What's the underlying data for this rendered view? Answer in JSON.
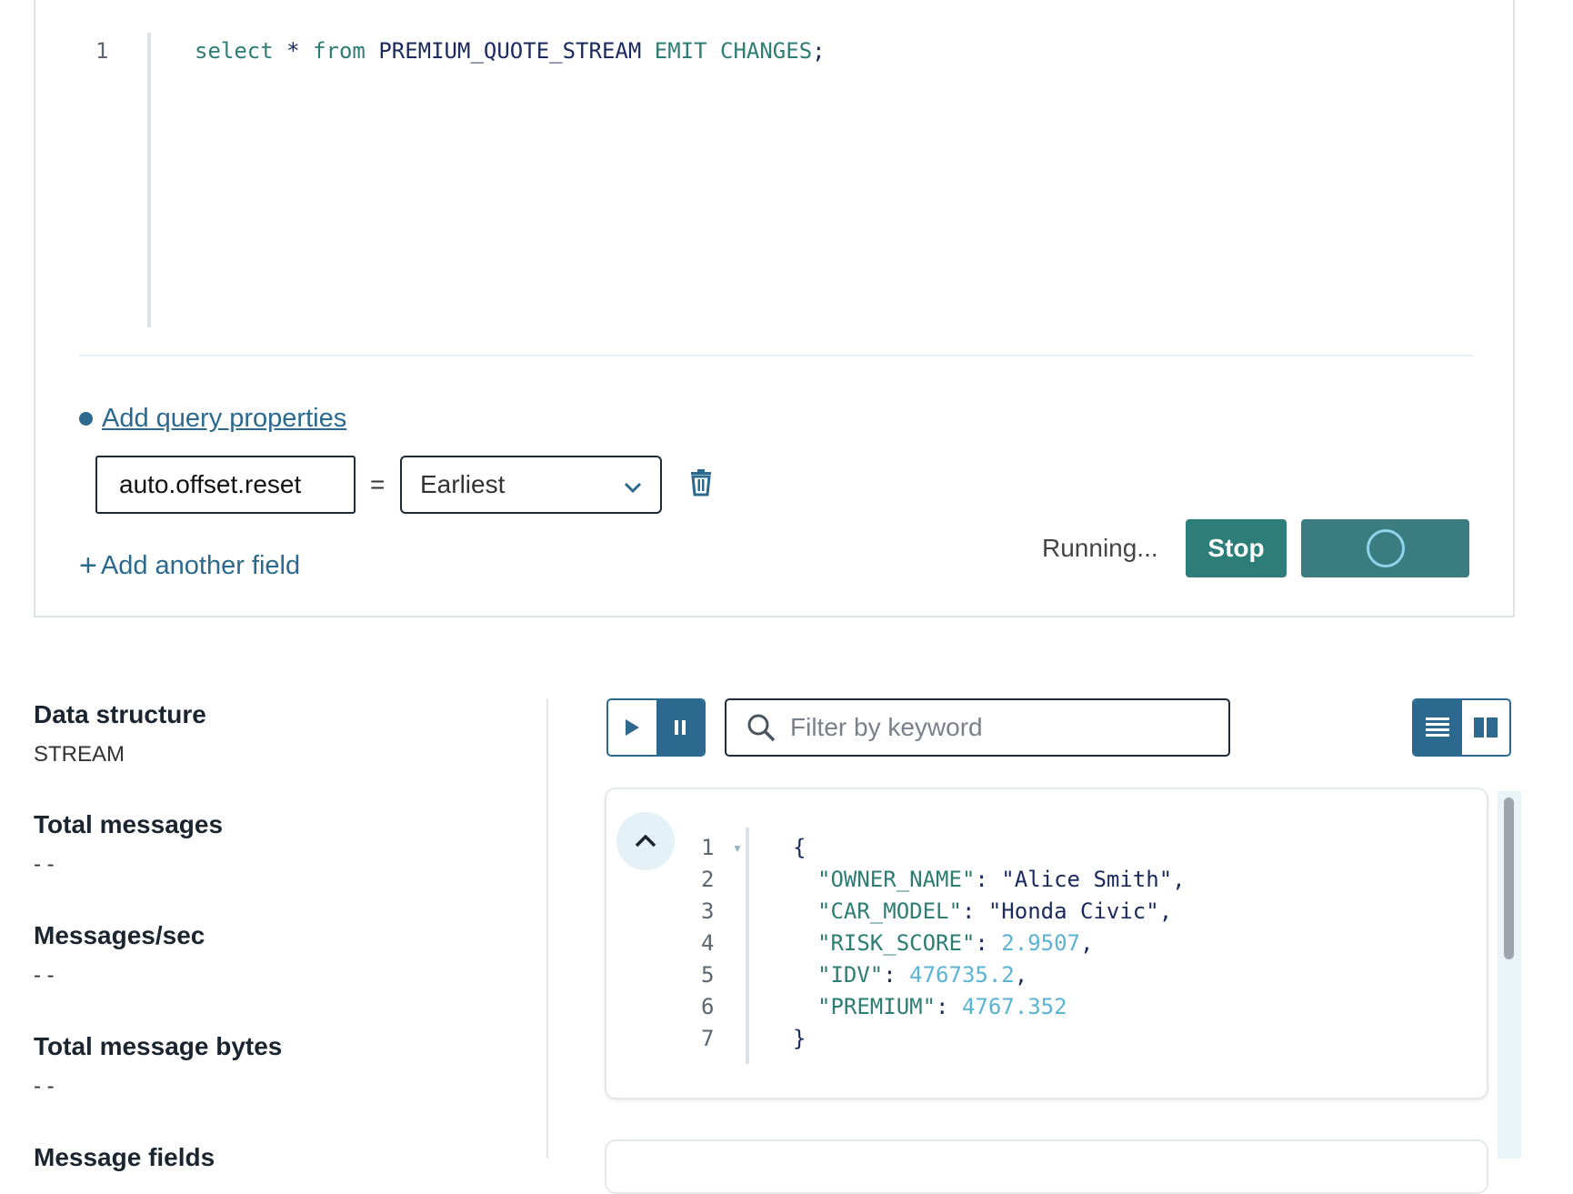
{
  "editor": {
    "line_number": "1",
    "tokens": {
      "select": "select",
      "star": "*",
      "from": "from",
      "stream": "PREMIUM_QUOTE_STREAM",
      "emit": "EMIT",
      "changes": "CHANGES",
      "semicolon": ";"
    }
  },
  "query_properties": {
    "link_label": "Add query properties",
    "key": "auto.offset.reset",
    "equals": "=",
    "value": "Earliest",
    "add_field_label": "Add another field",
    "add_field_plus": "+"
  },
  "run": {
    "status": "Running...",
    "stop_label": "Stop"
  },
  "stats": [
    {
      "label": "Data structure",
      "value": "STREAM"
    },
    {
      "label": "Total messages",
      "value": "- -"
    },
    {
      "label": "Messages/sec",
      "value": "- -"
    },
    {
      "label": "Total message bytes",
      "value": "- -"
    },
    {
      "label": "Message fields",
      "value": ""
    }
  ],
  "results": {
    "filter_placeholder": "Filter by keyword",
    "line_numbers": [
      "1",
      "2",
      "3",
      "4",
      "5",
      "6",
      "7"
    ],
    "message": {
      "open": "{",
      "fields": [
        {
          "key": "\"OWNER_NAME\"",
          "value": "\"Alice Smith\"",
          "type": "string",
          "sep": ","
        },
        {
          "key": "\"CAR_MODEL\"",
          "value": "\"Honda Civic\"",
          "type": "string",
          "sep": ","
        },
        {
          "key": "\"RISK_SCORE\"",
          "value": "2.9507",
          "type": "number",
          "sep": ","
        },
        {
          "key": "\"IDV\"",
          "value": "476735.2",
          "type": "number",
          "sep": ","
        },
        {
          "key": "\"PREMIUM\"",
          "value": "4767.352",
          "type": "number",
          "sep": ""
        }
      ],
      "close": "}"
    }
  },
  "colors": {
    "accent": "#2b6a8e",
    "stop_button": "#2d7d78",
    "json_key": "#2e7d74",
    "json_number": "#5bb3d5"
  },
  "icons": [
    "trash-icon",
    "chevron-down-icon",
    "play-icon",
    "pause-icon",
    "search-icon",
    "list-view-icon",
    "columns-view-icon",
    "chevron-up-icon",
    "spinner-icon"
  ]
}
